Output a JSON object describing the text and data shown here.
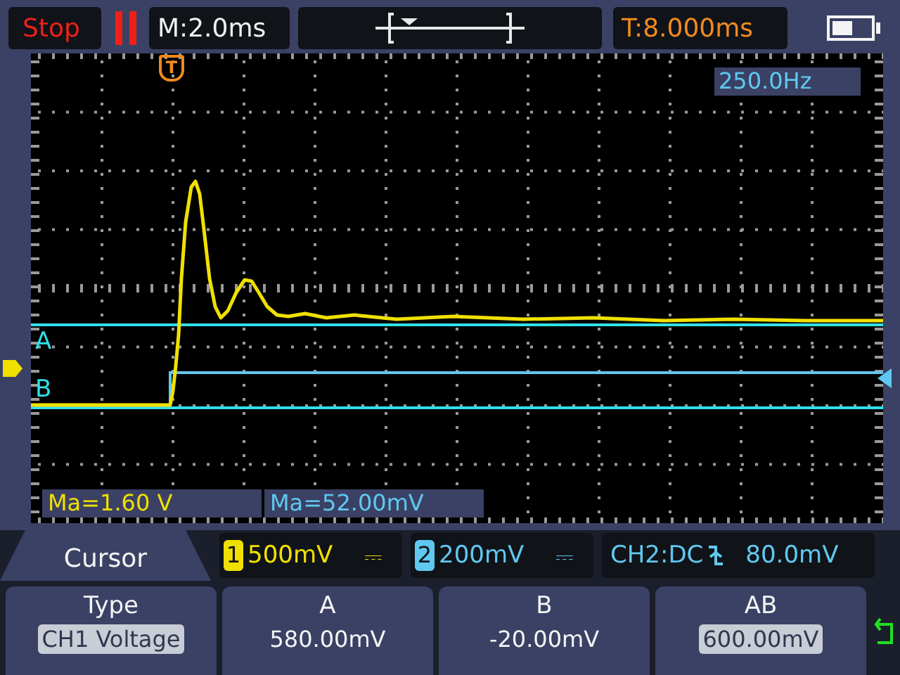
{
  "top_bar": {
    "run_state": "Stop",
    "paused": true,
    "timebase": "M:2.0ms",
    "trigger_time": "T:8.000ms"
  },
  "screen": {
    "trigger_marker": "T",
    "frequency": "250.0Hz",
    "cursors": [
      {
        "label": "A",
        "kind": "upper"
      },
      {
        "label": "B",
        "kind": "lower"
      }
    ],
    "measurements": [
      {
        "text": "Ma=1.60 V",
        "kind": "ch1"
      },
      {
        "text": "Ma=52.00mV",
        "kind": "ch2"
      }
    ]
  },
  "menu_title": "Cursor",
  "channels": [
    {
      "number": "1",
      "scale": "500mV",
      "coupling": "⎓",
      "color": "#f0e000"
    },
    {
      "number": "2",
      "scale": "200mV",
      "coupling": "⎓",
      "color": "#60c8f0"
    }
  ],
  "trigger": {
    "source": "CH2:DC",
    "level": "80.0mV"
  },
  "softkeys": [
    {
      "label": "Type",
      "value": "CH1 Voltage",
      "highlighted": true
    },
    {
      "label": "A",
      "value": "580.00mV",
      "highlighted": false
    },
    {
      "label": "B",
      "value": "-20.00mV",
      "highlighted": false
    },
    {
      "label": "AB",
      "value": "600.00mV",
      "highlighted": true
    }
  ]
}
